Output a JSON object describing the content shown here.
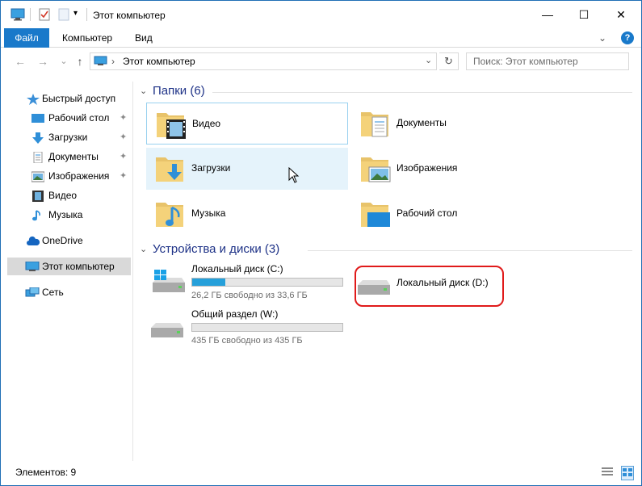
{
  "window": {
    "title": "Этот компьютер",
    "minimize_label": "—",
    "maximize_label": "☐",
    "close_label": "✕"
  },
  "ribbon": {
    "tabs": [
      "Файл",
      "Компьютер",
      "Вид"
    ],
    "collapse_label": "⌄",
    "help_label": "?"
  },
  "navigation": {
    "back_label": "←",
    "forward_label": "→",
    "history_label": "⌄",
    "up_label": "↑",
    "address_separator": "›",
    "address_path": "Этот компьютер",
    "address_dropdown": "⌄",
    "refresh_label": "↻",
    "search_placeholder": "Поиск: Этот компьютер"
  },
  "sidebar": {
    "quick_access": "Быстрый доступ",
    "quick_items": [
      {
        "label": "Рабочий стол",
        "pinned": true
      },
      {
        "label": "Загрузки",
        "pinned": true
      },
      {
        "label": "Документы",
        "pinned": true
      },
      {
        "label": "Изображения",
        "pinned": true
      },
      {
        "label": "Видео",
        "pinned": false
      },
      {
        "label": "Музыка",
        "pinned": false
      }
    ],
    "onedrive": "OneDrive",
    "this_pc": "Этот компьютер",
    "network": "Сеть",
    "pin_glyph": "✦"
  },
  "content": {
    "folders_header": "Папки (6)",
    "folders": [
      {
        "label": "Видео",
        "icon": "video-folder-icon"
      },
      {
        "label": "Документы",
        "icon": "documents-folder-icon"
      },
      {
        "label": "Загрузки",
        "icon": "downloads-folder-icon"
      },
      {
        "label": "Изображения",
        "icon": "pictures-folder-icon"
      },
      {
        "label": "Музыка",
        "icon": "music-folder-icon"
      },
      {
        "label": "Рабочий стол",
        "icon": "desktop-folder-icon"
      }
    ],
    "devices_header": "Устройства и диски (3)",
    "drives": [
      {
        "name": "Локальный диск (C:)",
        "free": "26,2 ГБ свободно из 33,6 ГБ",
        "used_fraction": 0.22,
        "icon": "windows-drive-icon"
      },
      {
        "name": "Локальный диск (D:)",
        "free": "",
        "used_fraction": null,
        "icon": "drive-icon"
      },
      {
        "name": "Общий раздел (W:)",
        "free": "435 ГБ свободно из 435 ГБ",
        "used_fraction": 0.0,
        "icon": "drive-icon"
      }
    ]
  },
  "status": {
    "items_count": "Элементов: 9"
  },
  "colors": {
    "accent": "#1979ca",
    "highlight_ring": "#e01a1a",
    "progress": "#26a0da",
    "group_title": "#1e3287"
  }
}
